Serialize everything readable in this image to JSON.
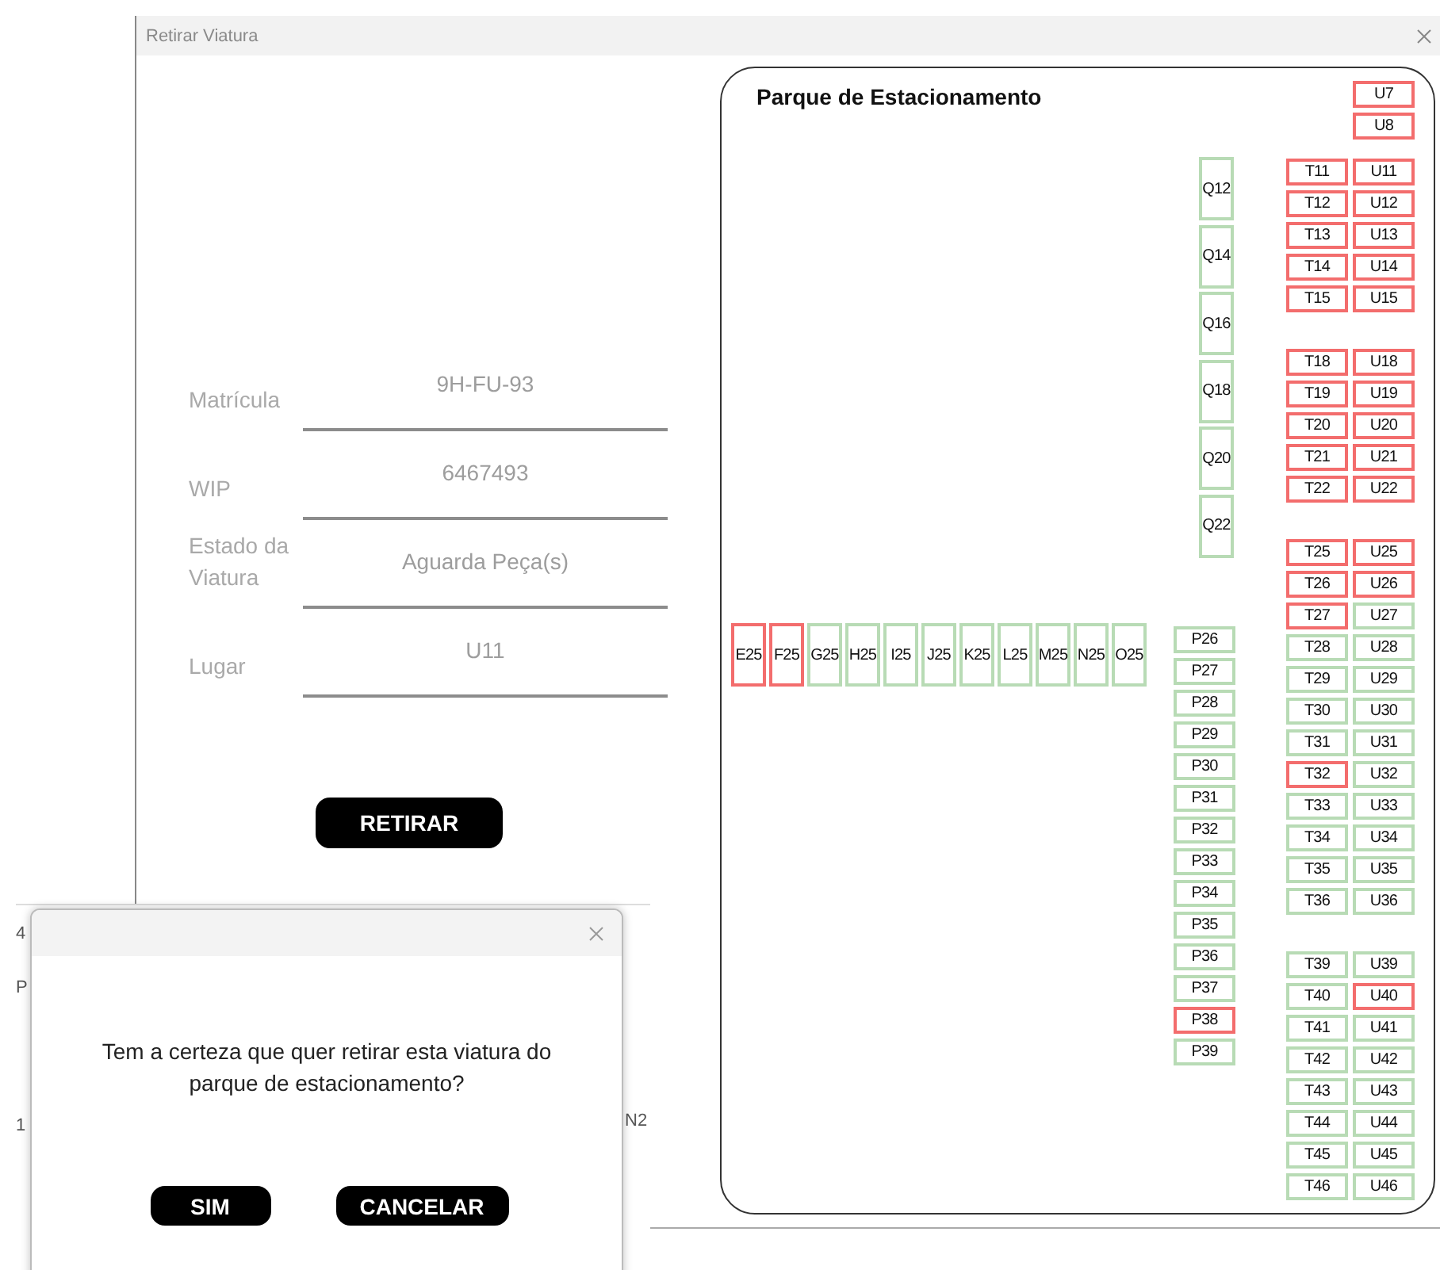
{
  "window": {
    "title": "Retirar Viatura"
  },
  "form": {
    "fields": [
      {
        "label": "Matrícula",
        "value": "9H-FU-93"
      },
      {
        "label": "WIP",
        "value": "6467493"
      },
      {
        "label": "Estado da Viatura",
        "value": "Aguarda Peça(s)"
      },
      {
        "label": "Lugar",
        "value": "U11"
      }
    ],
    "button": "RETIRAR"
  },
  "parking": {
    "title": "Parque de Estacionamento",
    "row_25": [
      {
        "label": "E25",
        "occupied": true
      },
      {
        "label": "F25",
        "occupied": true
      },
      {
        "label": "G25",
        "occupied": false
      },
      {
        "label": "H25",
        "occupied": false
      },
      {
        "label": "I25",
        "occupied": false
      },
      {
        "label": "J25",
        "occupied": false
      },
      {
        "label": "K25",
        "occupied": false
      },
      {
        "label": "L25",
        "occupied": false
      },
      {
        "label": "M25",
        "occupied": false
      },
      {
        "label": "N25",
        "occupied": false
      },
      {
        "label": "O25",
        "occupied": false
      }
    ],
    "q_column": [
      {
        "label": "Q12",
        "occupied": false
      },
      {
        "label": "Q14",
        "occupied": false
      },
      {
        "label": "Q16",
        "occupied": false
      },
      {
        "label": "Q18",
        "occupied": false
      },
      {
        "label": "Q20",
        "occupied": false
      },
      {
        "label": "Q22",
        "occupied": false
      }
    ],
    "p_column": [
      {
        "label": "P26",
        "occupied": false
      },
      {
        "label": "P27",
        "occupied": false
      },
      {
        "label": "P28",
        "occupied": false
      },
      {
        "label": "P29",
        "occupied": false
      },
      {
        "label": "P30",
        "occupied": false
      },
      {
        "label": "P31",
        "occupied": false
      },
      {
        "label": "P32",
        "occupied": false
      },
      {
        "label": "P33",
        "occupied": false
      },
      {
        "label": "P34",
        "occupied": false
      },
      {
        "label": "P35",
        "occupied": false
      },
      {
        "label": "P36",
        "occupied": false
      },
      {
        "label": "P37",
        "occupied": false
      },
      {
        "label": "P38",
        "occupied": true
      },
      {
        "label": "P39",
        "occupied": false
      }
    ],
    "t_u_blocks": [
      [
        [
          {
            "label": "U7",
            "occupied": true
          }
        ],
        [
          {
            "label": "U8",
            "occupied": true
          }
        ]
      ],
      [
        [
          {
            "label": "T11",
            "occupied": true
          },
          {
            "label": "U11",
            "occupied": true
          }
        ],
        [
          {
            "label": "T12",
            "occupied": true
          },
          {
            "label": "U12",
            "occupied": true
          }
        ],
        [
          {
            "label": "T13",
            "occupied": true
          },
          {
            "label": "U13",
            "occupied": true
          }
        ],
        [
          {
            "label": "T14",
            "occupied": true
          },
          {
            "label": "U14",
            "occupied": true
          }
        ],
        [
          {
            "label": "T15",
            "occupied": true
          },
          {
            "label": "U15",
            "occupied": true
          }
        ]
      ],
      [
        [
          {
            "label": "T18",
            "occupied": true
          },
          {
            "label": "U18",
            "occupied": true
          }
        ],
        [
          {
            "label": "T19",
            "occupied": true
          },
          {
            "label": "U19",
            "occupied": true
          }
        ],
        [
          {
            "label": "T20",
            "occupied": true
          },
          {
            "label": "U20",
            "occupied": true
          }
        ],
        [
          {
            "label": "T21",
            "occupied": true
          },
          {
            "label": "U21",
            "occupied": true
          }
        ],
        [
          {
            "label": "T22",
            "occupied": true
          },
          {
            "label": "U22",
            "occupied": true
          }
        ]
      ],
      [
        [
          {
            "label": "T25",
            "occupied": true
          },
          {
            "label": "U25",
            "occupied": true
          }
        ],
        [
          {
            "label": "T26",
            "occupied": true
          },
          {
            "label": "U26",
            "occupied": true
          }
        ],
        [
          {
            "label": "T27",
            "occupied": true
          },
          {
            "label": "U27",
            "occupied": false
          }
        ],
        [
          {
            "label": "T28",
            "occupied": false
          },
          {
            "label": "U28",
            "occupied": false
          }
        ],
        [
          {
            "label": "T29",
            "occupied": false
          },
          {
            "label": "U29",
            "occupied": false
          }
        ],
        [
          {
            "label": "T30",
            "occupied": false
          },
          {
            "label": "U30",
            "occupied": false
          }
        ],
        [
          {
            "label": "T31",
            "occupied": false
          },
          {
            "label": "U31",
            "occupied": false
          }
        ],
        [
          {
            "label": "T32",
            "occupied": true
          },
          {
            "label": "U32",
            "occupied": false
          }
        ],
        [
          {
            "label": "T33",
            "occupied": false
          },
          {
            "label": "U33",
            "occupied": false
          }
        ],
        [
          {
            "label": "T34",
            "occupied": false
          },
          {
            "label": "U34",
            "occupied": false
          }
        ],
        [
          {
            "label": "T35",
            "occupied": false
          },
          {
            "label": "U35",
            "occupied": false
          }
        ],
        [
          {
            "label": "T36",
            "occupied": false
          },
          {
            "label": "U36",
            "occupied": false
          }
        ]
      ],
      [
        [
          {
            "label": "T39",
            "occupied": false
          },
          {
            "label": "U39",
            "occupied": false
          }
        ],
        [
          {
            "label": "T40",
            "occupied": false
          },
          {
            "label": "U40",
            "occupied": true
          }
        ],
        [
          {
            "label": "T41",
            "occupied": false
          },
          {
            "label": "U41",
            "occupied": false
          }
        ],
        [
          {
            "label": "T42",
            "occupied": false
          },
          {
            "label": "U42",
            "occupied": false
          }
        ],
        [
          {
            "label": "T43",
            "occupied": false
          },
          {
            "label": "U43",
            "occupied": false
          }
        ],
        [
          {
            "label": "T44",
            "occupied": false
          },
          {
            "label": "U44",
            "occupied": false
          }
        ],
        [
          {
            "label": "T45",
            "occupied": false
          },
          {
            "label": "U45",
            "occupied": false
          }
        ],
        [
          {
            "label": "T46",
            "occupied": false
          },
          {
            "label": "U46",
            "occupied": false
          }
        ]
      ]
    ]
  },
  "background_window": {
    "texts": [
      "4",
      "P",
      "1",
      "N2"
    ]
  },
  "dialog": {
    "message": "Tem a certeza que quer retirar esta viatura do parque de estacionamento?",
    "buttons": [
      "SIM",
      "CANCELAR"
    ]
  }
}
